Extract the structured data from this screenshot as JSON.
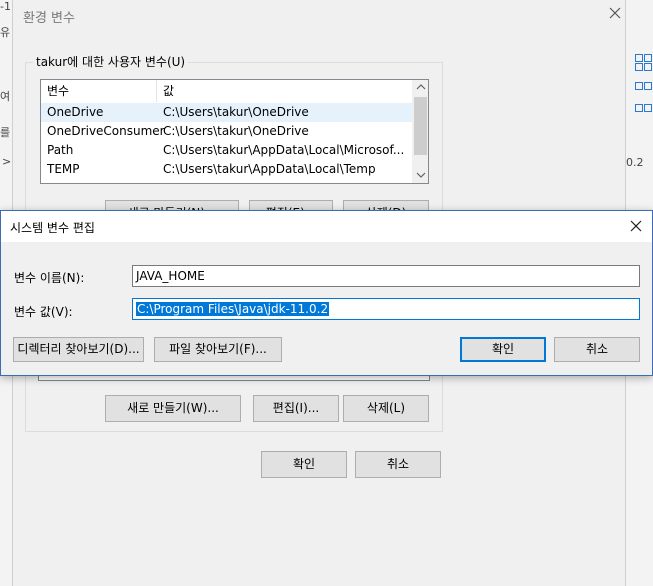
{
  "background": {
    "left_glyphs": [
      "-1",
      "유",
      "여",
      "를",
      ">"
    ],
    "right_text": "0.2"
  },
  "env_dialog": {
    "title": "환경 변수",
    "user_group_title": "takur에 대한 사용자 변수(U)",
    "columns": [
      "변수",
      "값"
    ],
    "rows": [
      {
        "name": "OneDrive",
        "value": "C:\\Users\\takur\\OneDrive"
      },
      {
        "name": "OneDriveConsumer",
        "value": "C:\\Users\\takur\\OneDrive"
      },
      {
        "name": "Path",
        "value": "C:\\Users\\takur\\AppData\\Local\\Microsof..."
      },
      {
        "name": "TEMP",
        "value": "C:\\Users\\takur\\AppData\\Local\\Temp"
      }
    ],
    "user_buttons": {
      "new": "새로 만들기(N)...",
      "edit": "편집(E)...",
      "delete": "삭제(D)"
    },
    "system_buttons": {
      "new": "새로 만들기(W)...",
      "edit": "편집(I)...",
      "delete": "삭제(L)"
    },
    "ok": "확인",
    "cancel": "취소"
  },
  "edit_dialog": {
    "title": "시스템 변수 편집",
    "name_label": "변수 이름(N):",
    "name_value": "JAVA_HOME",
    "value_label": "변수 값(V):",
    "value_value": "C:\\Program Files\\Java\\jdk-11.0.2",
    "browse_dir": "디렉터리 찾아보기(D)...",
    "browse_file": "파일 찾아보기(F)...",
    "ok": "확인",
    "cancel": "취소"
  },
  "colors": {
    "accent": "#0078d7",
    "selection": "#e5f1fb"
  }
}
